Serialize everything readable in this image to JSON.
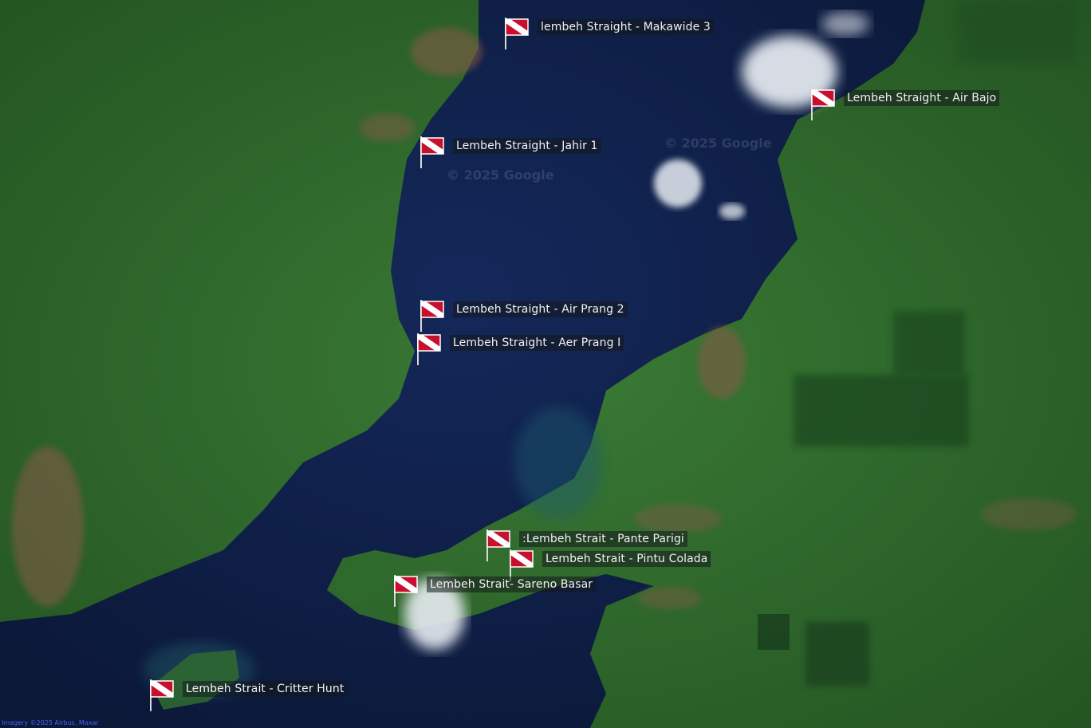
{
  "map": {
    "attribution": "Imagery ©2025 Airbus, Maxar",
    "watermark": "© 2025 Google",
    "flag_icon": "dive-flag-icon",
    "colors": {
      "land": "#2f6a2e",
      "water": "#0f2047",
      "flag_red": "#c8102e",
      "flag_white": "#ffffff"
    }
  },
  "markers": [
    {
      "label": "lembeh Straight - Makawide 3"
    },
    {
      "label": "Lembeh Straight - Air Bajo"
    },
    {
      "label": "Lembeh Straight - Jahir 1"
    },
    {
      "label": "Lembeh Straight - Air Prang 2"
    },
    {
      "label": "Lembeh Straight - Aer Prang I"
    },
    {
      "label": ":Lembeh Strait - Pante Parigi"
    },
    {
      "label": "Lembeh Strait - Pintu Colada"
    },
    {
      "label": "Lembeh Strait- Sareno Basar"
    },
    {
      "label": "Lembeh Strait - Critter Hunt"
    }
  ]
}
